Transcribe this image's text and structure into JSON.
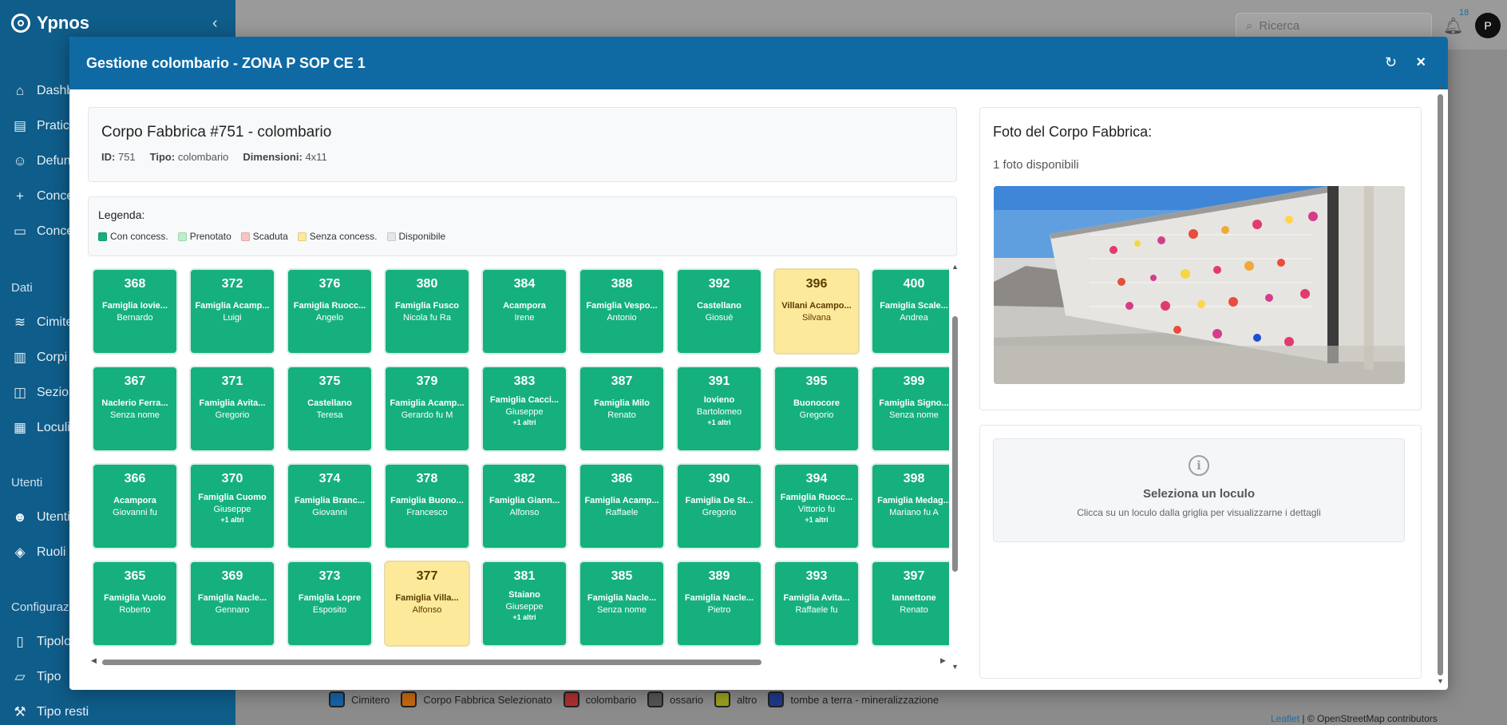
{
  "app": {
    "name": "Ypnos",
    "collapse_icon": "chevron-left-icon",
    "nav": [
      {
        "label": "Dashboard",
        "icon": "home-icon"
      },
      {
        "label": "Pratiche",
        "icon": "document-icon"
      },
      {
        "label": "Defunti",
        "icon": "person-icon"
      },
      {
        "label": "Concessionari",
        "icon": "person-add-icon"
      },
      {
        "label": "Concessioni",
        "icon": "wallet-icon"
      }
    ],
    "section_dati": "Dati",
    "nav_dati": [
      {
        "label": "Cimiteri",
        "icon": "database-icon"
      },
      {
        "label": "Corpi Fabbrica",
        "icon": "columns-icon"
      },
      {
        "label": "Sezioni",
        "icon": "map-icon"
      },
      {
        "label": "Loculi",
        "icon": "table-icon"
      }
    ],
    "section_utenti": "Utenti",
    "nav_utenti": [
      {
        "label": "Utenti",
        "icon": "users-icon"
      },
      {
        "label": "Ruoli",
        "icon": "shield-icon"
      }
    ],
    "section_config": "Configurazione",
    "nav_config": [
      {
        "label": "Tipologie",
        "icon": "book-icon"
      },
      {
        "label": "Tipo",
        "icon": "folder-icon"
      },
      {
        "label": "Tipo resti",
        "icon": "tool-icon"
      }
    ],
    "search_placeholder": "Ricerca",
    "notifications": "18",
    "avatar": "P"
  },
  "map_legend": [
    {
      "label": "Cimitero",
      "color": "#1565a8"
    },
    {
      "label": "Corpo Fabbrica Selezionato",
      "color": "#c96a10"
    },
    {
      "label": "colombario",
      "color": "#b03030"
    },
    {
      "label": "ossario",
      "color": "#555555"
    },
    {
      "label": "altro",
      "color": "#9aa020"
    },
    {
      "label": "tombe a terra - mineralizzazione",
      "color": "#1d3a8a"
    }
  ],
  "attribution": {
    "leaflet": "Leaflet",
    "rest": " | © OpenStreetMap contributors"
  },
  "modal": {
    "title": "Gestione colombario - ZONA P SOP CE 1",
    "refresh_icon": "refresh-icon",
    "close_icon": "close-icon",
    "info": {
      "title": "Corpo Fabbrica #751 - colombario",
      "id_label": "ID:",
      "id_value": "751",
      "tipo_label": "Tipo:",
      "tipo_value": "colombario",
      "dim_label": "Dimensioni:",
      "dim_value": "4x11"
    },
    "legend": {
      "title": "Legenda:",
      "items": [
        {
          "label": "Con concess.",
          "color": "#15b07e"
        },
        {
          "label": "Prenotato",
          "color": "#b9f0c9"
        },
        {
          "label": "Scaduta",
          "color": "#f7c4c4"
        },
        {
          "label": "Senza concess.",
          "color": "#fde99a"
        },
        {
          "label": "Disponibile",
          "color": "#e6e6e6"
        }
      ]
    },
    "loculi": [
      [
        {
          "num": "368",
          "fam": "Famiglia Iovie...",
          "nome": "Bernardo",
          "status": "green"
        },
        {
          "num": "372",
          "fam": "Famiglia Acamp...",
          "nome": "Luigi",
          "status": "green"
        },
        {
          "num": "376",
          "fam": "Famiglia Ruocc...",
          "nome": "Angelo",
          "status": "green"
        },
        {
          "num": "380",
          "fam": "Famiglia Fusco",
          "nome": "Nicola fu Ra",
          "status": "green"
        },
        {
          "num": "384",
          "fam": "Acampora",
          "nome": "Irene",
          "status": "green"
        },
        {
          "num": "388",
          "fam": "Famiglia Vespo...",
          "nome": "Antonio",
          "status": "green"
        },
        {
          "num": "392",
          "fam": "Castellano",
          "nome": "Giosuè",
          "status": "green"
        },
        {
          "num": "396",
          "fam": "Villani Acampo...",
          "nome": "Silvana",
          "status": "yellow"
        },
        {
          "num": "400",
          "fam": "Famiglia Scale...",
          "nome": "Andrea",
          "status": "green"
        }
      ],
      [
        {
          "num": "367",
          "fam": "Naclerio Ferra...",
          "nome": "Senza nome",
          "status": "green"
        },
        {
          "num": "371",
          "fam": "Famiglia Avita...",
          "nome": "Gregorio",
          "status": "green"
        },
        {
          "num": "375",
          "fam": "Castellano",
          "nome": "Teresa",
          "status": "green"
        },
        {
          "num": "379",
          "fam": "Famiglia Acamp...",
          "nome": "Gerardo fu M",
          "status": "green"
        },
        {
          "num": "383",
          "fam": "Famiglia Cacci...",
          "nome": "Giuseppe",
          "altri": "+1 altri",
          "status": "green"
        },
        {
          "num": "387",
          "fam": "Famiglia Milo",
          "nome": "Renato",
          "status": "green"
        },
        {
          "num": "391",
          "fam": "Iovieno",
          "nome": "Bartolomeo",
          "altri": "+1 altri",
          "status": "green"
        },
        {
          "num": "395",
          "fam": "Buonocore",
          "nome": "Gregorio",
          "status": "green"
        },
        {
          "num": "399",
          "fam": "Famiglia Signo...",
          "nome": "Senza nome",
          "status": "green"
        }
      ],
      [
        {
          "num": "366",
          "fam": "Acampora",
          "nome": "Giovanni fu",
          "status": "green"
        },
        {
          "num": "370",
          "fam": "Famiglia Cuomo",
          "nome": "Giuseppe",
          "altri": "+1 altri",
          "status": "green"
        },
        {
          "num": "374",
          "fam": "Famiglia Branc...",
          "nome": "Giovanni",
          "status": "green"
        },
        {
          "num": "378",
          "fam": "Famiglia Buono...",
          "nome": "Francesco",
          "status": "green"
        },
        {
          "num": "382",
          "fam": "Famiglia Giann...",
          "nome": "Alfonso",
          "status": "green"
        },
        {
          "num": "386",
          "fam": "Famiglia Acamp...",
          "nome": "Raffaele",
          "status": "green"
        },
        {
          "num": "390",
          "fam": "Famiglia De St...",
          "nome": "Gregorio",
          "status": "green"
        },
        {
          "num": "394",
          "fam": "Famiglia Ruocc...",
          "nome": "Vittorio fu",
          "altri": "+1 altri",
          "status": "green"
        },
        {
          "num": "398",
          "fam": "Famiglia Medag...",
          "nome": "Mariano fu A",
          "status": "green"
        }
      ],
      [
        {
          "num": "365",
          "fam": "Famiglia Vuolo",
          "nome": "Roberto",
          "status": "green"
        },
        {
          "num": "369",
          "fam": "Famiglia Nacle...",
          "nome": "Gennaro",
          "status": "green"
        },
        {
          "num": "373",
          "fam": "Famiglia Lopre",
          "nome": "Esposito",
          "status": "green"
        },
        {
          "num": "377",
          "fam": "Famiglia Villa...",
          "nome": "Alfonso",
          "status": "yellow"
        },
        {
          "num": "381",
          "fam": "Staiano",
          "nome": "Giuseppe",
          "altri": "+1 altri",
          "status": "green"
        },
        {
          "num": "385",
          "fam": "Famiglia Nacle...",
          "nome": "Senza nome",
          "status": "green"
        },
        {
          "num": "389",
          "fam": "Famiglia Nacle...",
          "nome": "Pietro",
          "status": "green"
        },
        {
          "num": "393",
          "fam": "Famiglia Avita...",
          "nome": "Raffaele fu",
          "status": "green"
        },
        {
          "num": "397",
          "fam": "Iannettone",
          "nome": "Renato",
          "status": "green"
        }
      ]
    ],
    "photo": {
      "title": "Foto del Corpo Fabbrica:",
      "count": "1 foto disponibili"
    },
    "details": {
      "icon": "info-icon",
      "title": "Seleziona un loculo",
      "subtitle": "Clicca su un loculo dalla griglia per visualizzarne i dettagli"
    }
  }
}
